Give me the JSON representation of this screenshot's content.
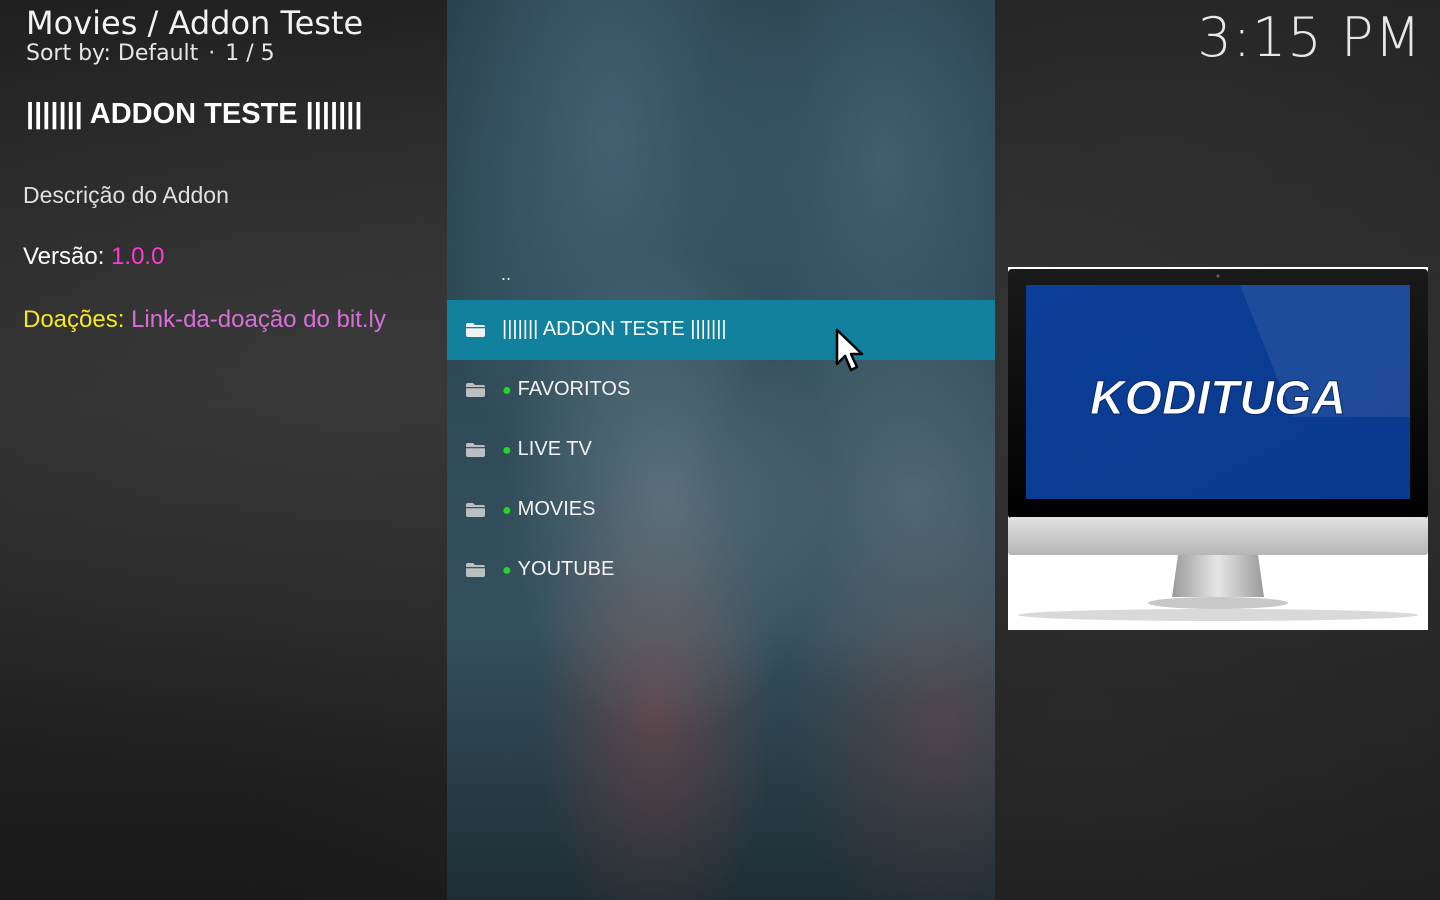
{
  "header": {
    "path": "Movies / Addon Teste",
    "sort_label": "Sort by: Default",
    "position": "1 / 5"
  },
  "clock": "3:15 PM",
  "info": {
    "title": "||||||| ADDON TESTE |||||||",
    "description": "Descrição do Addon",
    "version_label": "Versão:",
    "version_value": "1.0.0",
    "donate_label": "Doações:",
    "donate_value": "Link-da-doação do bit.ly"
  },
  "list": {
    "parent_label": "..",
    "items": [
      {
        "label": "||||||| ADDON TESTE |||||||",
        "selected": true,
        "dot": false
      },
      {
        "label": "FAVORITOS",
        "selected": false,
        "dot": true
      },
      {
        "label": "LIVE TV",
        "selected": false,
        "dot": true
      },
      {
        "label": "MOVIES",
        "selected": false,
        "dot": true
      },
      {
        "label": "YOUTUBE",
        "selected": false,
        "dot": true
      }
    ]
  },
  "poster": {
    "brand_text": "KODITUGA"
  },
  "colors": {
    "accent_selected": "#12819d",
    "version": "#ff3ad0",
    "donate_label": "#f5e626",
    "donate_value": "#d86fd8",
    "bullet": "#22d822",
    "screen_blue": "#0a3f97"
  },
  "icons": {
    "folder": "folder-icon",
    "cursor": "mouse-pointer-icon",
    "bullet": "green-dot-icon"
  }
}
